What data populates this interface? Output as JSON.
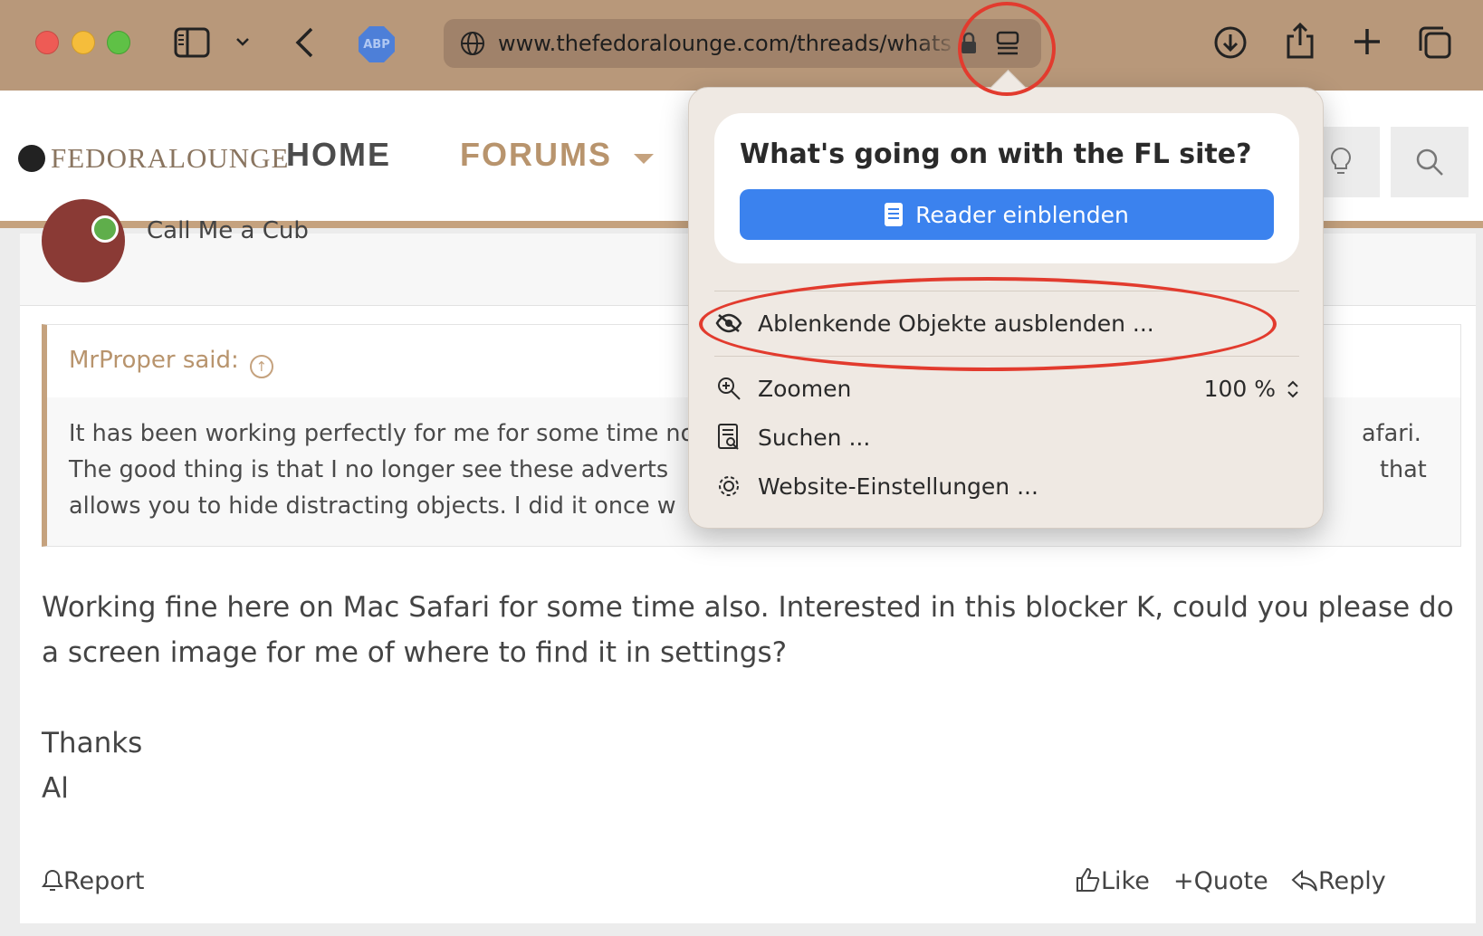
{
  "browser": {
    "url": "www.thefedoralounge.com/threads/whats",
    "extension_label": "ABP"
  },
  "site": {
    "logo_text": "FEDORALOUNGE",
    "nav": {
      "home": "HOME",
      "forums": "FORUMS"
    }
  },
  "post": {
    "author_partial": "Call Me a Cub",
    "quote": {
      "attribution": "MrProper said:",
      "lines": [
        "It has been working perfectly for me for some time now",
        "The good thing is that I no longer see these adverts",
        "allows you to hide distracting objects. I did it once w"
      ],
      "right_fragments": [
        "afari.",
        "that"
      ]
    },
    "body": [
      "Working fine here on Mac Safari for some time also. Interested in this blocker K, could you please do a screen image for me of where to find it in settings?",
      "Thanks",
      "Al"
    ],
    "actions": {
      "report": "Report",
      "like": "Like",
      "quote": "Quote",
      "reply": "Reply"
    }
  },
  "popover": {
    "title": "What's going on with the FL site?",
    "reader_button": "Reader einblenden",
    "items": {
      "hide_distracting": "Ablenkende Objekte ausblenden ...",
      "zoom": "Zoomen",
      "zoom_value": "100 %",
      "search": "Suchen ...",
      "website_settings": "Website-Einstellungen ..."
    }
  },
  "colors": {
    "toolbar": "#b8987a",
    "accent": "#c5a27e",
    "highlight_ring": "#e23b2e",
    "button_blue": "#3b82ee"
  }
}
